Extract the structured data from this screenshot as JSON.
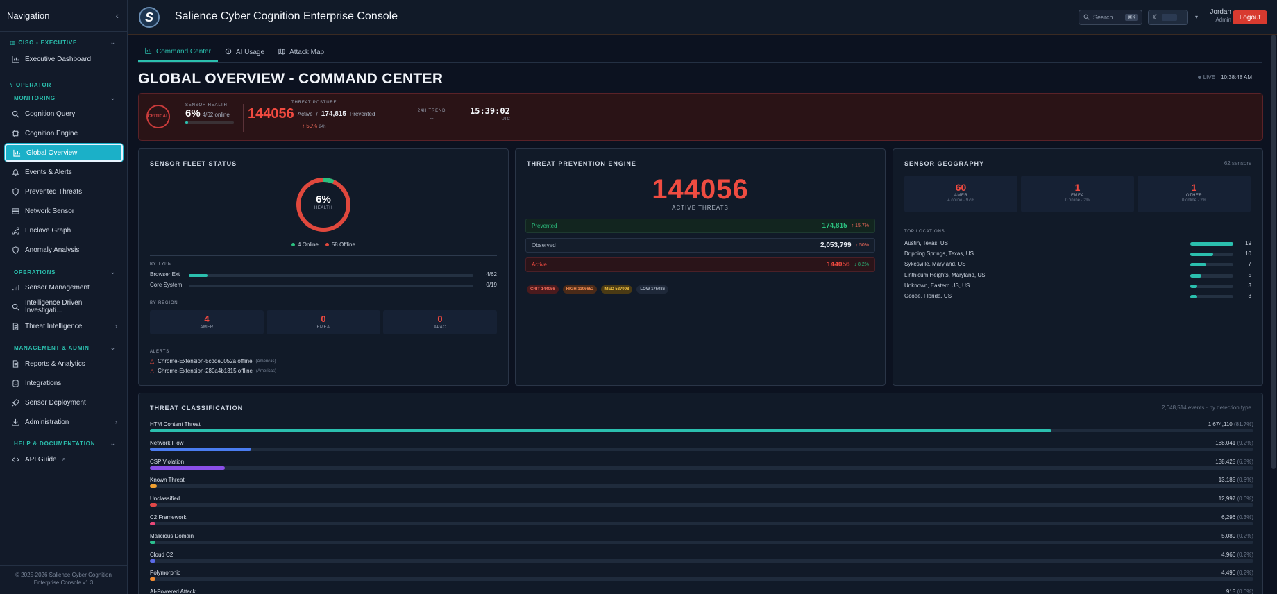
{
  "sidebar": {
    "title": "Navigation",
    "sections": {
      "ciso": "CISO - EXECUTIVE",
      "operator": "OPERATOR",
      "monitoring": "MONITORING",
      "operations": "OPERATIONS",
      "management": "MANAGEMENT & ADMIN",
      "help": "HELP & DOCUMENTATION"
    },
    "items": {
      "executive_dashboard": "Executive Dashboard",
      "cognition_query": "Cognition Query",
      "cognition_engine": "Cognition Engine",
      "global_overview": "Global Overview",
      "events_alerts": "Events & Alerts",
      "prevented_threats": "Prevented Threats",
      "network_sensor": "Network Sensor",
      "enclave_graph": "Enclave Graph",
      "anomaly_analysis": "Anomaly Analysis",
      "sensor_management": "Sensor Management",
      "intel_investigation": "Intelligence Driven Investigati...",
      "threat_intelligence": "Threat Intelligence",
      "reports_analytics": "Reports & Analytics",
      "integrations": "Integrations",
      "sensor_deployment": "Sensor Deployment",
      "administration": "Administration",
      "api_guide": "API Guide"
    },
    "footer": "© 2025-2026 Salience Cyber Cognition Enterprise Console v1.3"
  },
  "topbar": {
    "logo_letter": "S",
    "title": "Salience Cyber Cognition Enterprise Console",
    "search_placeholder": "Search...",
    "search_kbd": "⌘K",
    "user_name": "Jordan",
    "user_role": "Admin",
    "logout": "Logout"
  },
  "tabs": [
    "Command Center",
    "AI Usage",
    "Attack Map"
  ],
  "page": {
    "title": "GLOBAL OVERVIEW - COMMAND CENTER",
    "live": "LIVE",
    "time": "10:38:48 AM"
  },
  "status": {
    "badge": "CRITICAL",
    "sensor_health_label": "SENSOR HEALTH",
    "sensor_health_value": "6%",
    "sensor_online": "4/62 online",
    "sensor_health_fraction": 0.06,
    "threat_posture_label": "THREAT POSTURE",
    "active_count": "144056",
    "active_label": "Active",
    "slash": "/",
    "prevented_count": "174,815",
    "prevented_label": "Prevented",
    "change": "↑ 50%",
    "change_period": "24h",
    "trend_label": "24H TREND",
    "trend_value": "--",
    "clock": "15:39:02",
    "clock_zone": "UTC"
  },
  "fleet": {
    "title": "SENSOR FLEET STATUS",
    "health_pct": "6%",
    "health_label": "HEALTH",
    "online_fraction": 0.065,
    "online": "4 Online",
    "offline": "58 Offline",
    "by_type_label": "BY TYPE",
    "types": [
      {
        "name": "Browser Ext",
        "value": "4/62",
        "fraction": 0.065
      },
      {
        "name": "Core System",
        "value": "0/19",
        "fraction": 0
      }
    ],
    "by_region_label": "BY REGION",
    "regions": [
      {
        "value": "4",
        "label": "AMER"
      },
      {
        "value": "0",
        "label": "EMEA"
      },
      {
        "value": "0",
        "label": "APAC"
      }
    ],
    "alerts_label": "ALERTS",
    "alerts": [
      {
        "text": "Chrome-Extension-5cdde0052a offline",
        "region": "(Americas)"
      },
      {
        "text": "Chrome-Extension-280a4b1315 offline",
        "region": "(Americas)"
      }
    ]
  },
  "prevention": {
    "title": "THREAT PREVENTION ENGINE",
    "active": "144056",
    "active_label": "ACTIVE THREATS",
    "rows": [
      {
        "label": "Prevented",
        "value": "174,815",
        "change": "↑ 15.7%"
      },
      {
        "label": "Observed",
        "value": "2,053,799",
        "change": "↑ 50%"
      },
      {
        "label": "Active",
        "value": "144056",
        "change": "↓ 8.2%"
      }
    ],
    "chips": [
      "CRIT 144056",
      "HIGH 1196652",
      "MED 537998",
      "LOW 175036"
    ]
  },
  "geography": {
    "title": "SENSOR GEOGRAPHY",
    "count": "62 sensors",
    "boxes": [
      {
        "value": "60",
        "label": "AMER",
        "sub": "4 online · 97%"
      },
      {
        "value": "1",
        "label": "EMEA",
        "sub": "0 online · 2%"
      },
      {
        "value": "1",
        "label": "OTHER",
        "sub": "0 online · 2%"
      }
    ],
    "top_label": "TOP LOCATIONS",
    "locations": [
      {
        "name": "Austin, Texas, US",
        "value": "19",
        "fraction": 1.0
      },
      {
        "name": "Dripping Springs, Texas, US",
        "value": "10",
        "fraction": 0.53
      },
      {
        "name": "Sykesville, Maryland, US",
        "value": "7",
        "fraction": 0.37
      },
      {
        "name": "Linthicum Heights, Maryland, US",
        "value": "5",
        "fraction": 0.26
      },
      {
        "name": "Unknown, Eastern US, US",
        "value": "3",
        "fraction": 0.16
      },
      {
        "name": "Ocoee, Florida, US",
        "value": "3",
        "fraction": 0.16
      }
    ]
  },
  "classification": {
    "title": "THREAT CLASSIFICATION",
    "summary": "2,048,514 events · by detection type",
    "rows": [
      {
        "name": "HTM Content Threat",
        "value": "1,674,110",
        "pct": "(81.7%)",
        "fraction": 0.817,
        "color": "#2bbfae"
      },
      {
        "name": "Network Flow",
        "value": "188,041",
        "pct": "(9.2%)",
        "fraction": 0.092,
        "color": "#4a7cf0"
      },
      {
        "name": "CSP Violation",
        "value": "138,425",
        "pct": "(6.8%)",
        "fraction": 0.068,
        "color": "#8a4fe8"
      },
      {
        "name": "Known Threat",
        "value": "13,185",
        "pct": "(0.6%)",
        "fraction": 0.006,
        "color": "#f0a030"
      },
      {
        "name": "Unclassified",
        "value": "12,997",
        "pct": "(0.6%)",
        "fraction": 0.006,
        "color": "#e04848"
      },
      {
        "name": "C2 Framework",
        "value": "6,296",
        "pct": "(0.3%)",
        "fraction": 0.003,
        "color": "#e84878"
      },
      {
        "name": "Malicious Domain",
        "value": "5,089",
        "pct": "(0.2%)",
        "fraction": 0.002,
        "color": "#2bbf8e"
      },
      {
        "name": "Cloud C2",
        "value": "4,966",
        "pct": "(0.2%)",
        "fraction": 0.002,
        "color": "#5a6ae8"
      },
      {
        "name": "Polymorphic",
        "value": "4,490",
        "pct": "(0.2%)",
        "fraction": 0.002,
        "color": "#f08a30"
      },
      {
        "name": "AI-Powered Attack",
        "value": "915",
        "pct": "(0.0%)",
        "fraction": 0.0,
        "color": "#c848e8"
      }
    ]
  }
}
